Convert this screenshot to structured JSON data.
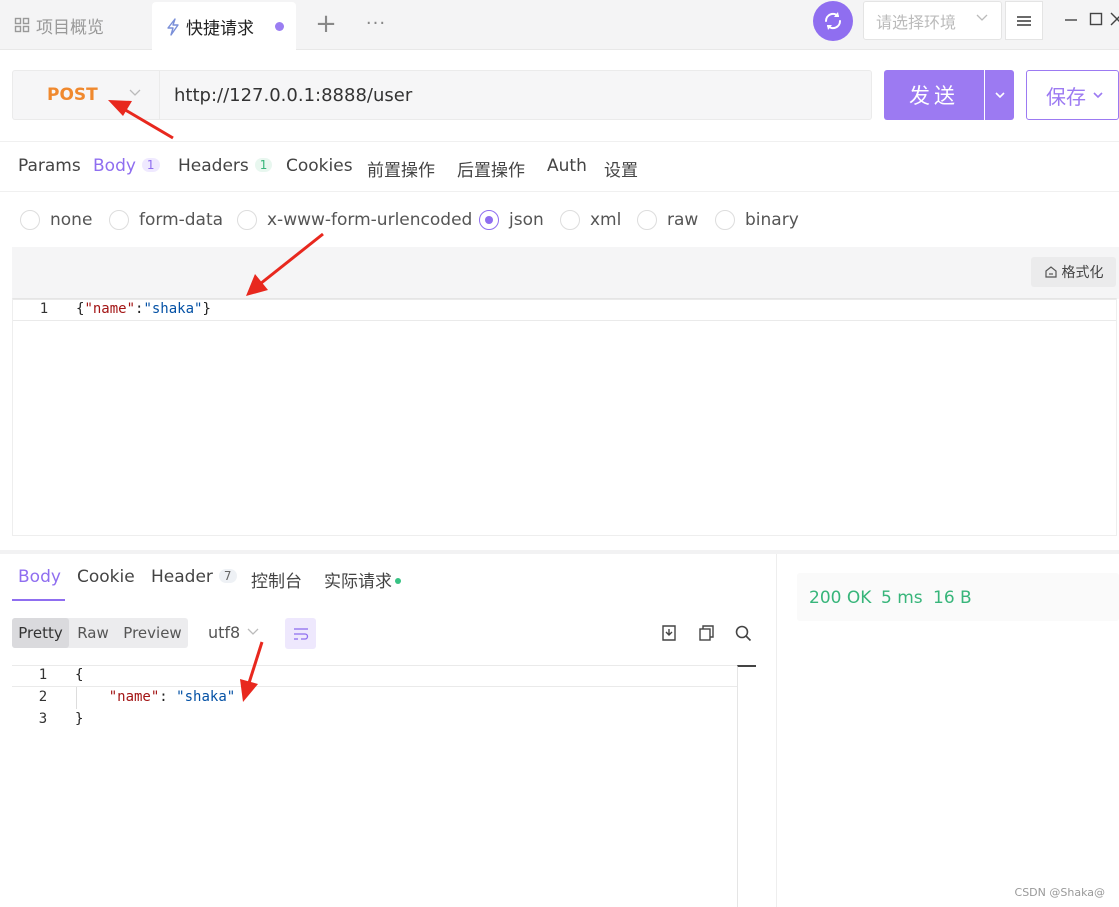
{
  "tabs": {
    "overview_label": "项目概览",
    "quick_label": "快捷请求",
    "add_symbol": "+",
    "more_symbol": "···"
  },
  "environment": {
    "placeholder": "请选择环境"
  },
  "request": {
    "method": "POST",
    "url": "http://127.0.0.1:8888/user",
    "send_label": "发送",
    "save_label": "保存"
  },
  "request_tabs": [
    {
      "label": "Params"
    },
    {
      "label": "Body",
      "badge": "1"
    },
    {
      "label": "Headers",
      "badge": "1"
    },
    {
      "label": "Cookies"
    },
    {
      "label": "前置操作"
    },
    {
      "label": "后置操作"
    },
    {
      "label": "Auth"
    },
    {
      "label": "设置"
    }
  ],
  "body_types": [
    "none",
    "form-data",
    "x-www-form-urlencoded",
    "json",
    "xml",
    "raw",
    "binary"
  ],
  "selected_body_type": "json",
  "format_label": "格式化",
  "request_body": {
    "line_number": "1",
    "code": "{\"name\":\"shaka\"}"
  },
  "response_tabs": [
    {
      "label": "Body"
    },
    {
      "label": "Cookie"
    },
    {
      "label": "Header",
      "badge": "7"
    },
    {
      "label": "控制台"
    },
    {
      "label": "实际请求"
    }
  ],
  "view_modes": [
    "Pretty",
    "Raw",
    "Preview"
  ],
  "encoding": "utf8",
  "response_body": {
    "line_numbers": [
      "1",
      "2",
      "3"
    ],
    "lines": [
      "{",
      "    \"name\": \"shaka\"",
      "}"
    ]
  },
  "status": {
    "code": "200 OK",
    "time": "5 ms",
    "size": "16 B"
  },
  "watermark": "CSDN @Shaka@",
  "colors": {
    "accent": "#9c7af2",
    "method": "#f0892e",
    "success": "#37b57a"
  }
}
